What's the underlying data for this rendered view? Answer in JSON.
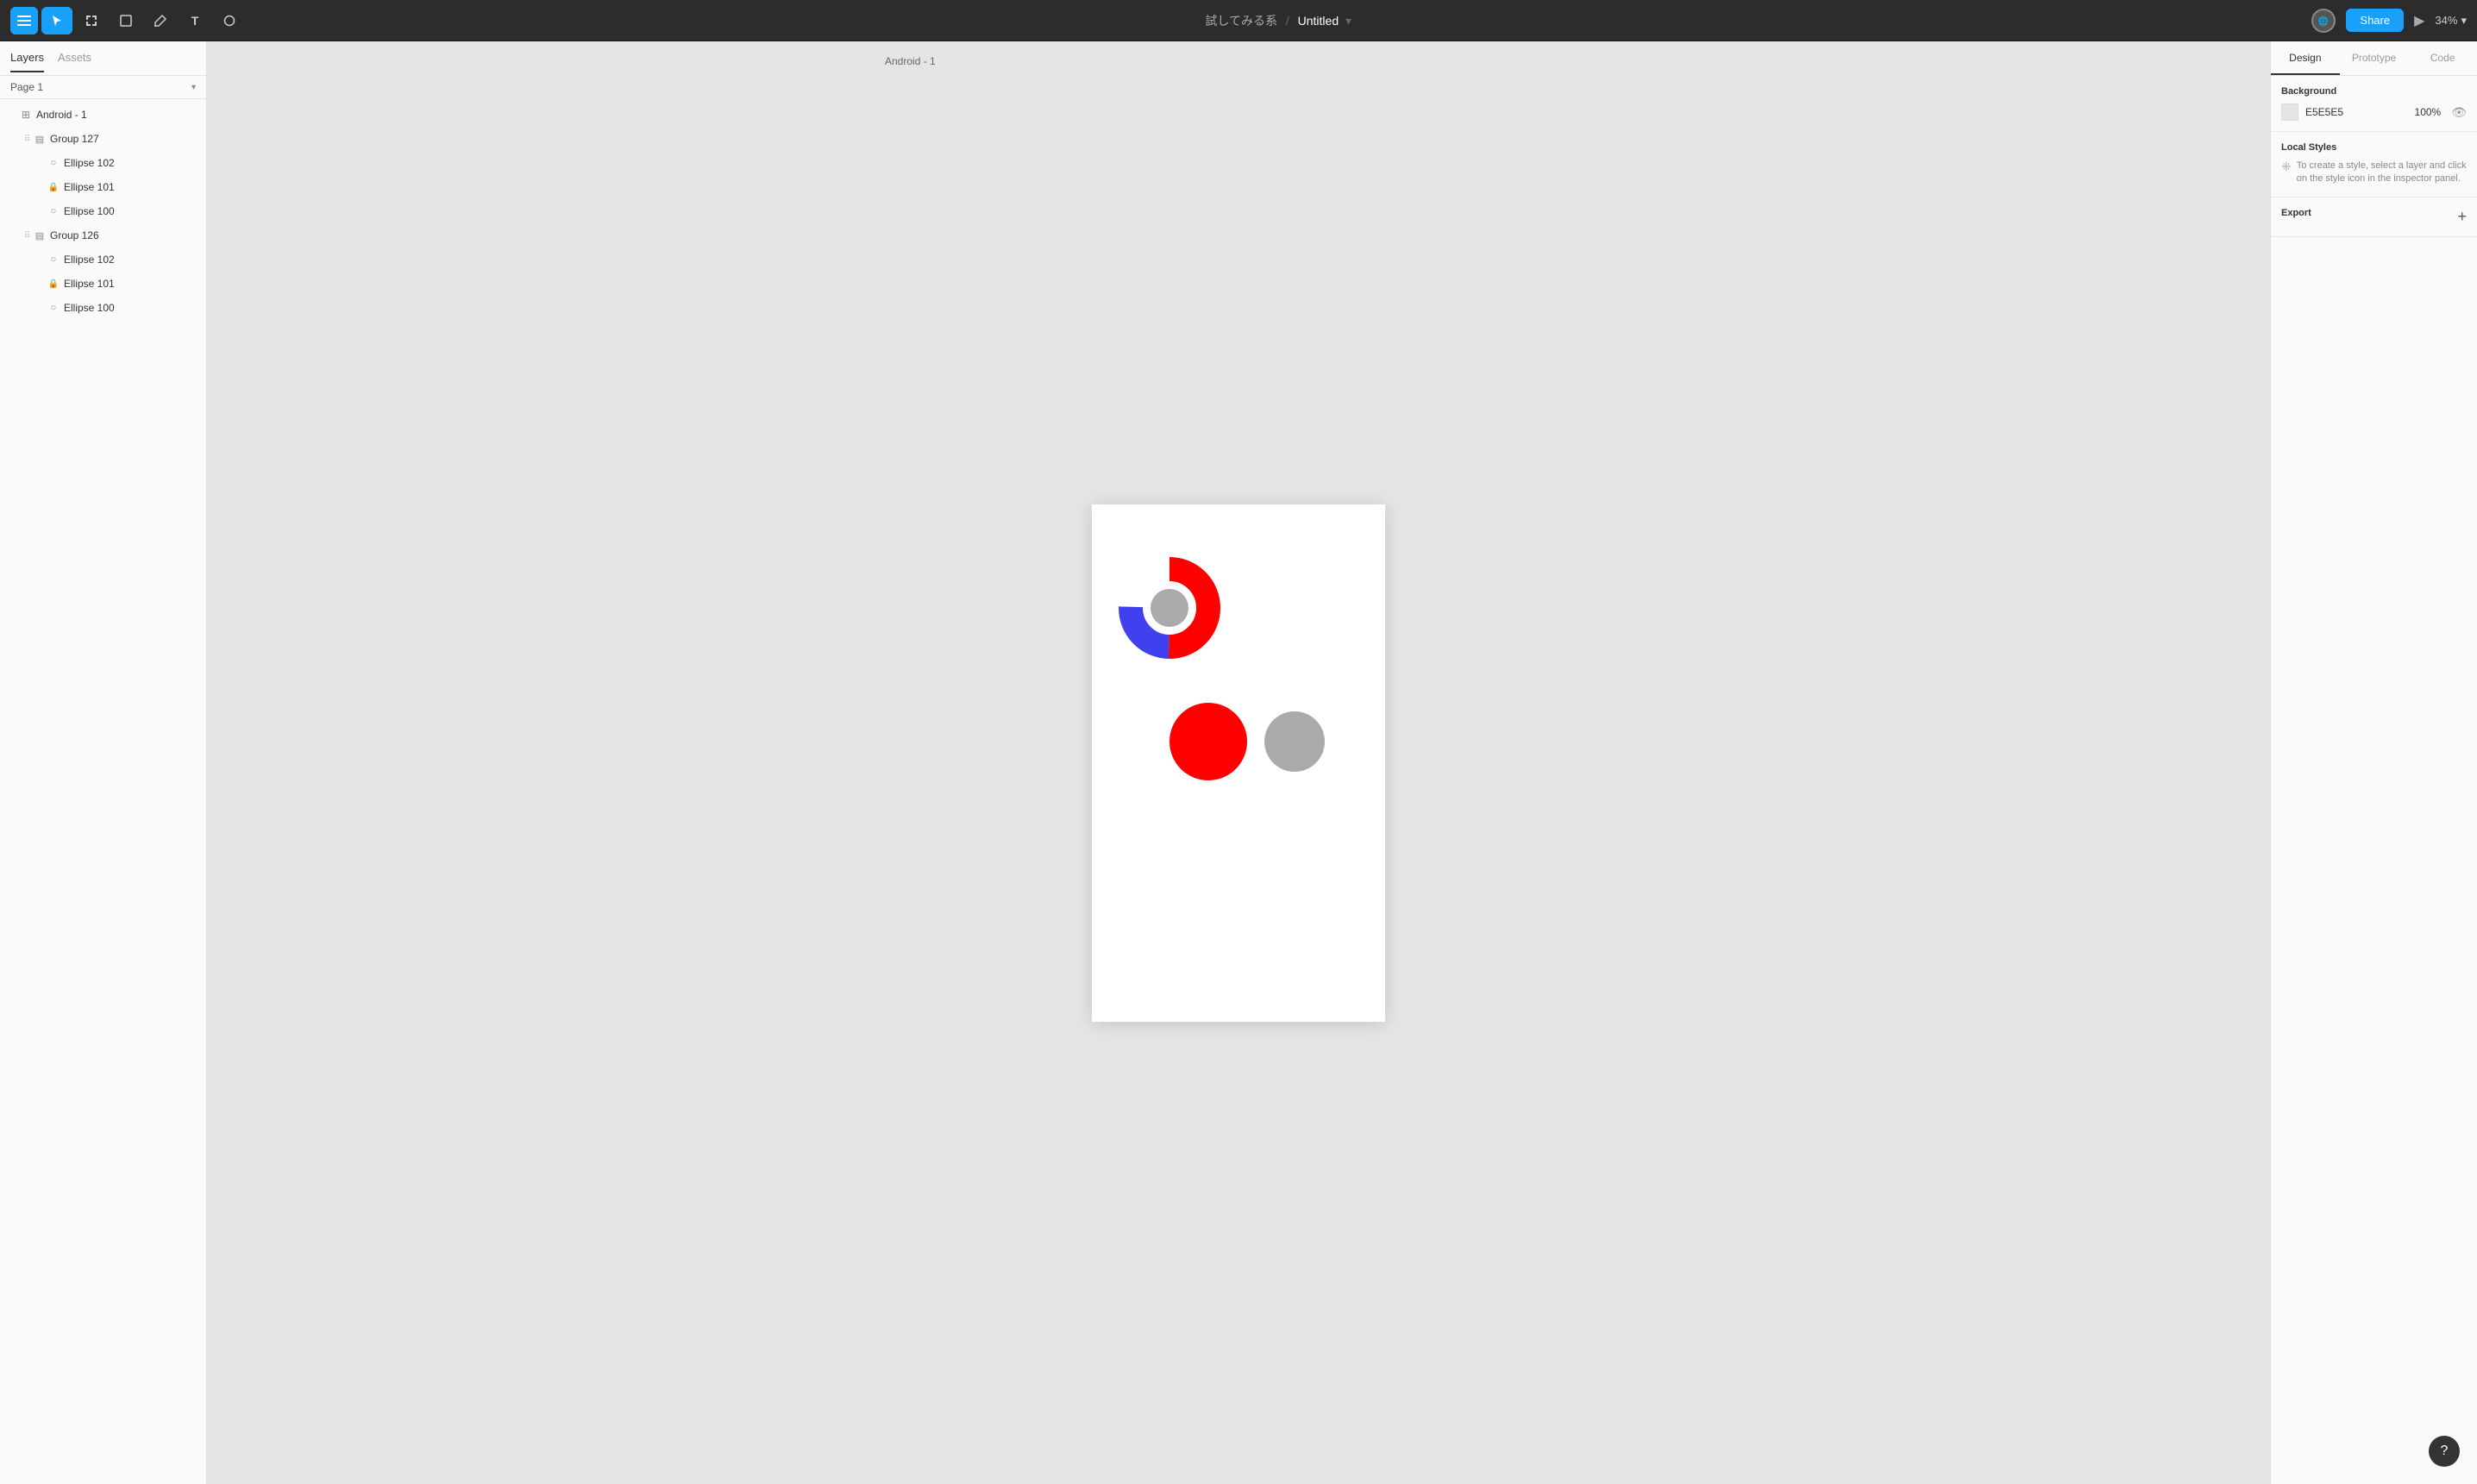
{
  "toolbar": {
    "menu_label": "menu",
    "breadcrumb_prefix": "試してみる系",
    "separator": "/",
    "file_title": "Untitled",
    "share_label": "Share",
    "zoom_label": "34%",
    "tools": [
      {
        "id": "select",
        "icon": "▲",
        "active": true
      },
      {
        "id": "frame",
        "icon": "⊞",
        "active": false
      },
      {
        "id": "rect",
        "icon": "□",
        "active": false
      },
      {
        "id": "pen",
        "icon": "✏",
        "active": false
      },
      {
        "id": "text",
        "icon": "T",
        "active": false
      },
      {
        "id": "comment",
        "icon": "○",
        "active": false
      }
    ]
  },
  "left_panel": {
    "tabs": [
      {
        "id": "layers",
        "label": "Layers",
        "active": true
      },
      {
        "id": "assets",
        "label": "Assets",
        "active": false
      }
    ],
    "page_selector": "Page 1",
    "layers": [
      {
        "id": "android1",
        "label": "Android - 1",
        "indent": 0,
        "type": "frame",
        "icon": "⊞",
        "drag": false
      },
      {
        "id": "group127",
        "label": "Group 127",
        "indent": 1,
        "type": "group",
        "icon": "▤",
        "drag": true
      },
      {
        "id": "ellipse102a",
        "label": "Ellipse 102",
        "indent": 2,
        "type": "ellipse",
        "icon": "○",
        "drag": false
      },
      {
        "id": "ellipse101a",
        "label": "Ellipse 101",
        "indent": 2,
        "type": "ellipse",
        "icon": "○",
        "drag": false
      },
      {
        "id": "ellipse100a",
        "label": "Ellipse 100",
        "indent": 2,
        "type": "ellipse",
        "icon": "○",
        "drag": false
      },
      {
        "id": "group126",
        "label": "Group 126",
        "indent": 1,
        "type": "group",
        "icon": "▤",
        "drag": true
      },
      {
        "id": "ellipse102b",
        "label": "Ellipse 102",
        "indent": 2,
        "type": "ellipse",
        "icon": "○",
        "drag": false
      },
      {
        "id": "ellipse101b",
        "label": "Ellipse 101",
        "indent": 2,
        "type": "ellipse",
        "icon": "○",
        "drag": false
      },
      {
        "id": "ellipse100b",
        "label": "Ellipse 100",
        "indent": 2,
        "type": "ellipse",
        "icon": "○",
        "drag": false
      }
    ]
  },
  "canvas": {
    "frame_label": "Android - 1"
  },
  "right_panel": {
    "tabs": [
      {
        "id": "design",
        "label": "Design",
        "active": true
      },
      {
        "id": "prototype",
        "label": "Prototype",
        "active": false
      },
      {
        "id": "code",
        "label": "Code",
        "active": false
      }
    ],
    "background_section": {
      "title": "Background",
      "color_hex": "E5E5E5",
      "opacity": "100%"
    },
    "local_styles": {
      "title": "Local Styles",
      "hint": "To create a style, select a layer and click on the style icon in the inspector panel."
    },
    "export": {
      "title": "Export"
    }
  },
  "help": {
    "label": "?"
  }
}
